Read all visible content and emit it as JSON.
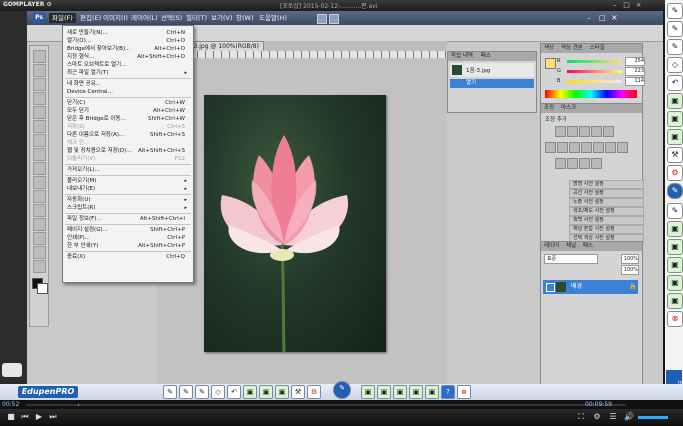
{
  "player": {
    "logo": "GOMPLAYER ⚙",
    "title": "[포토샵] 2015-02-12-...........편.avi",
    "time_current": "00:52",
    "time_total": "00:09:59"
  },
  "photoshop": {
    "logo": "Ps",
    "menus": [
      "파일(F)",
      "편집(E)",
      "이미지(I)",
      "레이어(L)",
      "선택(S)",
      "필터(T)",
      "보기(V)",
      "창(W)",
      "도움말(H)"
    ],
    "active_menu": "파일(F)",
    "doc_tab": "1꼼-3.jpg @ 100%(RGB/8)",
    "file_menu": [
      {
        "label": "새로 만들기(N)...",
        "shortcut": "Ctrl+N"
      },
      {
        "label": "열기(O)...",
        "shortcut": "Ctrl+O"
      },
      {
        "label": "Bridge에서 찾아보기(B)...",
        "shortcut": "Alt+Ctrl+O"
      },
      {
        "label": "지정 형식...",
        "shortcut": "Alt+Shift+Ctrl+O"
      },
      {
        "label": "스마트 오브젝트로 열기...",
        "shortcut": ""
      },
      {
        "label": "최근 파일 열기(T)",
        "shortcut": "",
        "submenu": true
      },
      {
        "sep": true
      },
      {
        "label": "내 화면 공유...",
        "shortcut": ""
      },
      {
        "label": "Device Central...",
        "shortcut": ""
      },
      {
        "sep": true
      },
      {
        "label": "닫기(C)",
        "shortcut": "Ctrl+W"
      },
      {
        "label": "모두 닫기",
        "shortcut": "Alt+Ctrl+W"
      },
      {
        "label": "닫은 후 Bridge로 이동...",
        "shortcut": "Shift+Ctrl+W"
      },
      {
        "label": "저장(S)",
        "shortcut": "Ctrl+S",
        "disabled": true
      },
      {
        "label": "다른 이름으로 저장(A)...",
        "shortcut": "Shift+Ctrl+S"
      },
      {
        "label": "체크 인...",
        "shortcut": "",
        "disabled": true
      },
      {
        "label": "웹 및 장치용으로 저장(D)...",
        "shortcut": "Alt+Shift+Ctrl+S"
      },
      {
        "label": "되돌리기(V)",
        "shortcut": "F12",
        "disabled": true
      },
      {
        "sep": true
      },
      {
        "label": "가져오기(L)...",
        "shortcut": ""
      },
      {
        "sep": true
      },
      {
        "label": "불러오기(M)",
        "shortcut": "",
        "submenu": true
      },
      {
        "label": "내보내기(E)",
        "shortcut": "",
        "submenu": true
      },
      {
        "sep": true
      },
      {
        "label": "자동화(U)",
        "shortcut": "",
        "submenu": true
      },
      {
        "label": "스크립트(R)",
        "shortcut": "",
        "submenu": true
      },
      {
        "sep": true
      },
      {
        "label": "파일 정보(F)...",
        "shortcut": "Alt+Shift+Ctrl+I"
      },
      {
        "sep": true
      },
      {
        "label": "페이지 설정(G)...",
        "shortcut": "Shift+Ctrl+P"
      },
      {
        "label": "인쇄(P)...",
        "shortcut": "Ctrl+P"
      },
      {
        "label": "한 부 인쇄(Y)",
        "shortcut": "Alt+Shift+Ctrl+P"
      },
      {
        "sep": true
      },
      {
        "label": "종료(X)",
        "shortcut": "Ctrl+Q"
      }
    ],
    "history_panel": {
      "tabs": [
        "작업 내역",
        "패스"
      ],
      "snapshot": "1꼼-3.jpg",
      "step": "열기"
    },
    "color_panel": {
      "tabs": [
        "색상",
        "색상 견본",
        "스타일"
      ],
      "r": "254",
      "g": "223",
      "b": "114"
    },
    "adjust_panel": {
      "tabs": [
        "조정",
        "마스크"
      ],
      "title": "조정 추가",
      "presets": [
        "명명 사전 설정",
        "곡선 사전 설정",
        "노출 사전 설정",
        "색조/채도 사전 설정",
        "흑백 사전 설정",
        "채널 혼합 사전 설정",
        "선택 색상 사전 설정"
      ]
    },
    "layers_panel": {
      "tabs": [
        "레이어",
        "채널",
        "패스"
      ],
      "blend": "표준",
      "opacity": "100%",
      "fill": "100%",
      "layer_name": "배경"
    }
  },
  "edupen": {
    "logo": "EdupenPRO"
  }
}
